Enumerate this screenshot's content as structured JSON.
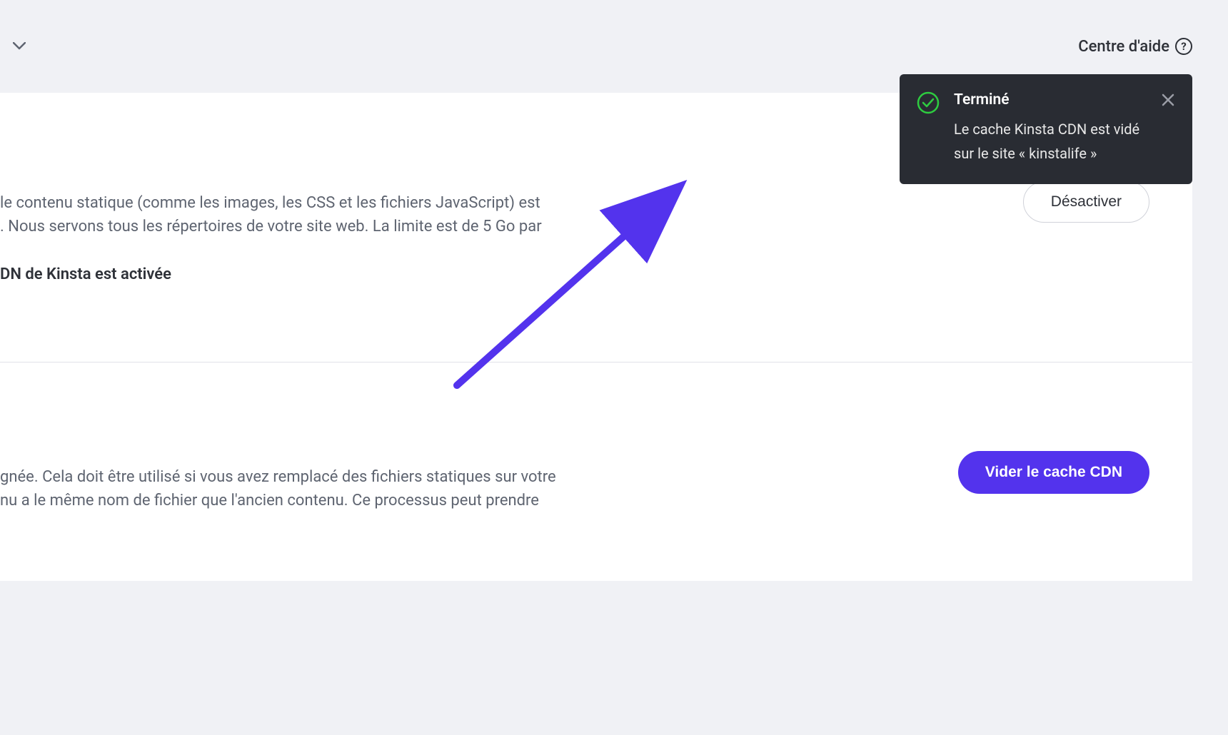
{
  "header": {
    "help_center_label": "Centre d'aide"
  },
  "toast": {
    "title": "Terminé",
    "message": "Le cache Kinsta CDN est vidé sur le site « kinstalife »"
  },
  "cdn_section": {
    "description_line1": "le contenu statique (comme les images, les CSS et les fichiers JavaScript) est",
    "description_line2": ". Nous servons tous les répertoires de votre site web. La limite est de 5 Go par",
    "status_text": "DN de Kinsta est activée",
    "disable_button": "Désactiver"
  },
  "cache_section": {
    "description_line1": "gnée. Cela doit être utilisé si vous avez remplacé des fichiers statiques sur votre",
    "description_line2": "nu a le même nom de fichier que l'ancien contenu. Ce processus peut prendre",
    "clear_button": "Vider le cache CDN"
  },
  "colors": {
    "primary": "#5333ed",
    "toast_bg": "#292c33",
    "success": "#2ecc40"
  }
}
